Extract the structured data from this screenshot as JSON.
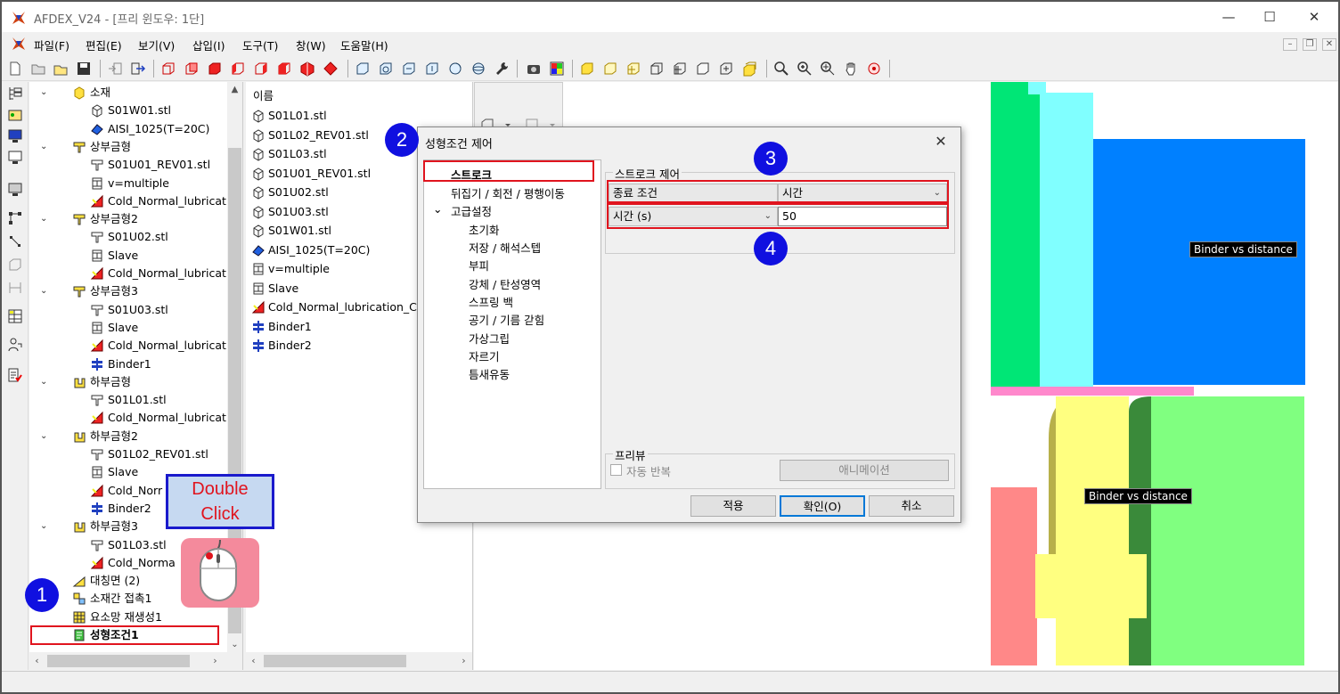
{
  "window": {
    "title": "AFDEX_V24 - [프리 윈도우: 1단]",
    "minimize": "—",
    "maximize": "☐",
    "close": "✕"
  },
  "menu": [
    "파일(F)",
    "편집(E)",
    "보기(V)",
    "삽입(I)",
    "도구(T)",
    "창(W)",
    "도움말(H)"
  ],
  "tree": {
    "items": [
      {
        "label": "소재",
        "icon": "material-icon",
        "chev": "⌄",
        "level": 0
      },
      {
        "label": "S01W01.stl",
        "icon": "stl-file-icon",
        "level": 1
      },
      {
        "label": "AISI_1025(T=20C)",
        "icon": "material-property-icon",
        "level": 1
      },
      {
        "label": "상부금형",
        "icon": "upper-die-icon",
        "chev": "⌄",
        "level": 0
      },
      {
        "label": "S01U01_REV01.stl",
        "icon": "die-stl-icon",
        "level": 1
      },
      {
        "label": "v=multiple",
        "icon": "press-icon",
        "level": 1
      },
      {
        "label": "Cold_Normal_lubricat",
        "icon": "lubrication-icon",
        "level": 1
      },
      {
        "label": "상부금형2",
        "icon": "upper-die-icon",
        "chev": "⌄",
        "level": 0
      },
      {
        "label": "S01U02.stl",
        "icon": "die-stl-icon",
        "level": 1
      },
      {
        "label": "Slave",
        "icon": "press-icon",
        "level": 1
      },
      {
        "label": "Cold_Normal_lubricat",
        "icon": "lubrication-icon",
        "level": 1
      },
      {
        "label": "상부금형3",
        "icon": "upper-die-icon",
        "chev": "⌄",
        "level": 0
      },
      {
        "label": "S01U03.stl",
        "icon": "die-stl-icon",
        "level": 1
      },
      {
        "label": "Slave",
        "icon": "press-icon",
        "level": 1
      },
      {
        "label": "Cold_Normal_lubricat",
        "icon": "lubrication-icon",
        "level": 1
      },
      {
        "label": "Binder1",
        "icon": "binder-icon",
        "level": 1
      },
      {
        "label": "하부금형",
        "icon": "lower-die-icon",
        "chev": "⌄",
        "level": 0
      },
      {
        "label": "S01L01.stl",
        "icon": "die-stl-icon",
        "level": 1
      },
      {
        "label": "Cold_Normal_lubricat",
        "icon": "lubrication-icon",
        "level": 1
      },
      {
        "label": "하부금형2",
        "icon": "lower-die-icon",
        "chev": "⌄",
        "level": 0
      },
      {
        "label": "S01L02_REV01.stl",
        "icon": "die-stl-icon",
        "level": 1
      },
      {
        "label": "Slave",
        "icon": "press-icon",
        "level": 1
      },
      {
        "label": "Cold_Norr",
        "icon": "lubrication-icon",
        "level": 1
      },
      {
        "label": "Binder2",
        "icon": "binder-icon",
        "level": 1
      },
      {
        "label": "하부금형3",
        "icon": "lower-die-icon",
        "chev": "⌄",
        "level": 0
      },
      {
        "label": "S01L03.stl",
        "icon": "die-stl-icon",
        "level": 1
      },
      {
        "label": "Cold_Norma",
        "icon": "lubrication-icon",
        "level": 1
      },
      {
        "label": "대칭면 (2)",
        "icon": "symmetry-icon",
        "level": 0
      },
      {
        "label": "소재간 접촉1",
        "icon": "contact-icon",
        "level": 0
      },
      {
        "label": "요소망 재생성1",
        "icon": "remesh-icon",
        "level": 0
      },
      {
        "label": "성형조건1",
        "icon": "process-condition-icon",
        "level": 0,
        "bold": true
      }
    ]
  },
  "list": {
    "header": "이름",
    "items": [
      {
        "label": "S01L01.stl",
        "icon": "stl-file-icon"
      },
      {
        "label": "S01L02_REV01.stl",
        "icon": "stl-file-icon"
      },
      {
        "label": "S01L03.stl",
        "icon": "stl-file-icon"
      },
      {
        "label": "S01U01_REV01.stl",
        "icon": "stl-file-icon"
      },
      {
        "label": "S01U02.stl",
        "icon": "stl-file-icon"
      },
      {
        "label": "S01U03.stl",
        "icon": "stl-file-icon"
      },
      {
        "label": "S01W01.stl",
        "icon": "stl-file-icon"
      },
      {
        "label": "AISI_1025(T=20C)",
        "icon": "material-property-icon"
      },
      {
        "label": "v=multiple",
        "icon": "press-icon"
      },
      {
        "label": "Slave",
        "icon": "press-icon"
      },
      {
        "label": "Cold_Normal_lubrication_Co",
        "icon": "lubrication-icon"
      },
      {
        "label": "Binder1",
        "icon": "binder-icon"
      },
      {
        "label": "Binder2",
        "icon": "binder-icon"
      }
    ]
  },
  "dialog": {
    "title": "성형조건 제어",
    "close": "✕",
    "nav": {
      "stroke": "스트로크",
      "flip": "뒤집기 / 회전 / 평행이동",
      "advanced": "고급설정",
      "sub": [
        "초기화",
        "저장 / 해석스텝",
        "부피",
        "강체 / 탄성영역",
        "스프링 백",
        "공기 / 기름 갇힘",
        "가상그립",
        "자르기",
        "틈새유동"
      ]
    },
    "stroke_group": {
      "title": "스트로크 제어",
      "end_condition_label": "종료 조건",
      "end_condition_value": "시간",
      "time_unit_value": "시간 (s)",
      "time_value": "50"
    },
    "preview": {
      "title": "프리뷰",
      "auto_repeat": "자동 반복",
      "animation": "애니메이션"
    },
    "buttons": {
      "apply": "적용",
      "ok": "확인(O)",
      "cancel": "취소"
    }
  },
  "annotations": {
    "step1": "1",
    "step2": "2",
    "step3": "3",
    "step4": "4",
    "double_line1": "Double",
    "double_line2": "Click"
  },
  "viewport": {
    "label_top": "Binder vs distance",
    "label_bottom": "Binder vs distance",
    "colors": {
      "green": "#00e676",
      "cyan": "#80ffff",
      "blue": "#0080ff",
      "pink": "#ff88cc",
      "yellow": "#ffff80",
      "lightgreen": "#80ff80",
      "salmon": "#ff8888",
      "olive": "#b8b04a",
      "darkgreen": "#3a8a3a"
    }
  }
}
